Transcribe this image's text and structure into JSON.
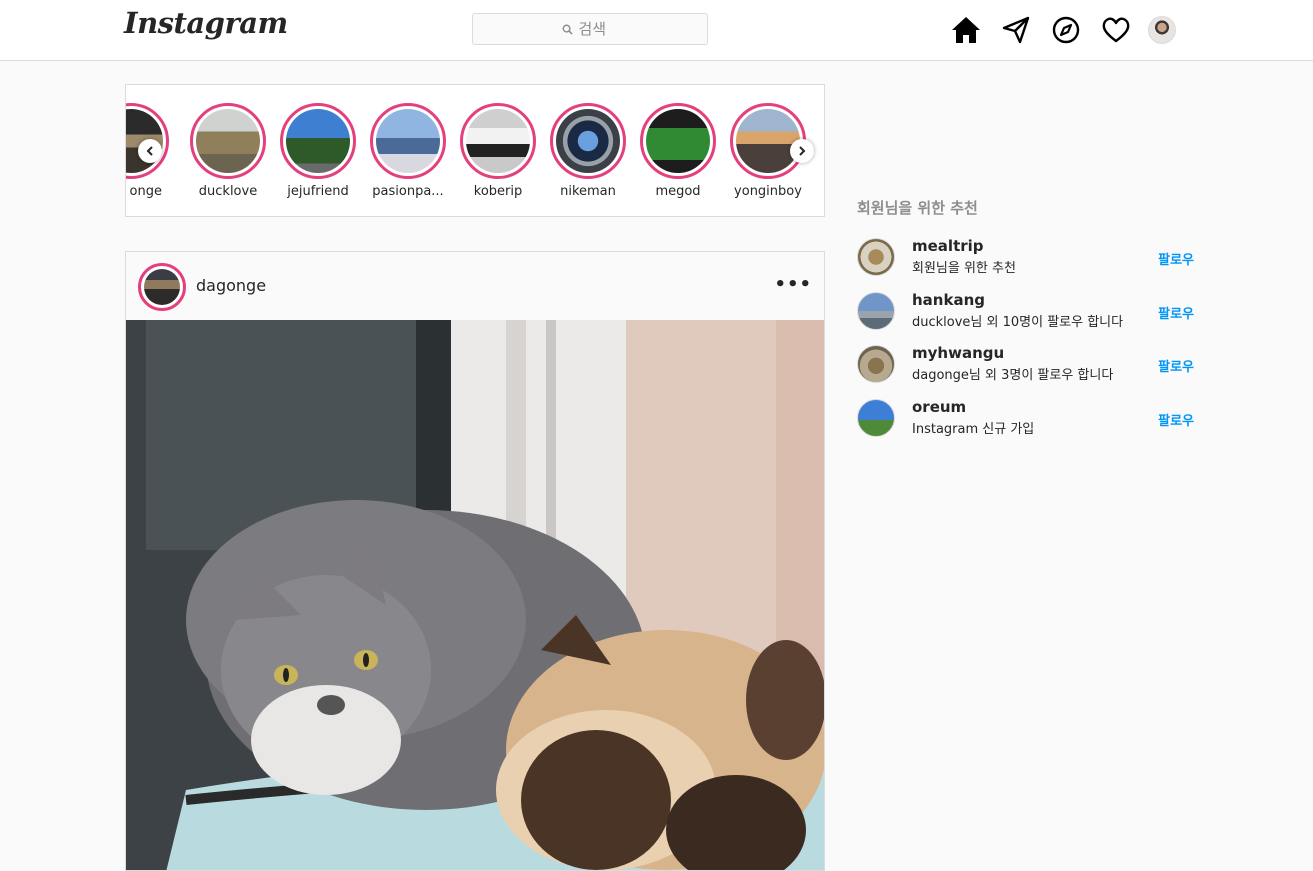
{
  "header": {
    "logo": "Instagram",
    "search_placeholder": "검색",
    "icons": [
      "home-icon",
      "direct-message-icon",
      "explore-icon",
      "heart-icon",
      "profile-avatar"
    ]
  },
  "stories": [
    {
      "name": "onge"
    },
    {
      "name": "ducklove"
    },
    {
      "name": "jejufriend"
    },
    {
      "name": "pasionpa..."
    },
    {
      "name": "koberip"
    },
    {
      "name": "nikeman"
    },
    {
      "name": "megod"
    },
    {
      "name": "yonginboy"
    }
  ],
  "post": {
    "username": "dagonge",
    "more_label": "•••"
  },
  "recommendations": {
    "title": "회원님을 위한 추천",
    "items": [
      {
        "username": "mealtrip",
        "description": "회원님을 위한 추천",
        "follow_label": "팔로우"
      },
      {
        "username": "hankang",
        "description": "ducklove님 외 10명이 팔로우 합니다",
        "follow_label": "팔로우"
      },
      {
        "username": "myhwangu",
        "description": "dagonge님 외 3명이 팔로우 합니다",
        "follow_label": "팔로우"
      },
      {
        "username": "oreum",
        "description": "Instagram 신규 가입",
        "follow_label": "팔로우"
      }
    ]
  },
  "colors": {
    "story_ring": "#e4407e",
    "follow_link": "#0095f6",
    "border": "#dbdbdb"
  }
}
